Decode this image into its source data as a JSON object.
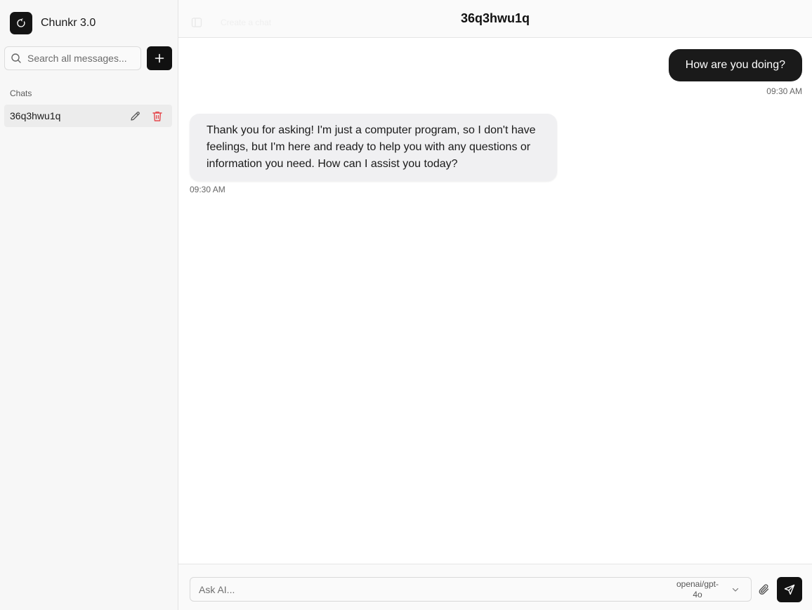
{
  "sidebar": {
    "app_title": "Chunkr 3.0",
    "search_placeholder": "Search all messages...",
    "section_label": "Chats",
    "chats": [
      {
        "label": "36q3hwu1q"
      }
    ]
  },
  "header": {
    "title": "36q3hwu1q",
    "faded_text": "Create a chat"
  },
  "messages": [
    {
      "role": "user",
      "text": "How are you doing?",
      "time": "09:30 AM"
    },
    {
      "role": "assistant",
      "text": "Thank you for asking! I'm just a computer program, so I don't have feelings, but I'm here and ready to help you with any questions or information you need. How can I assist you today?",
      "time": "09:30 AM"
    }
  ],
  "composer": {
    "placeholder": "Ask AI...",
    "model": "openai/gpt-4o"
  },
  "colors": {
    "accent": "#111111",
    "delete": "#e5484d",
    "sidebar_bg": "#f7f7f7"
  }
}
